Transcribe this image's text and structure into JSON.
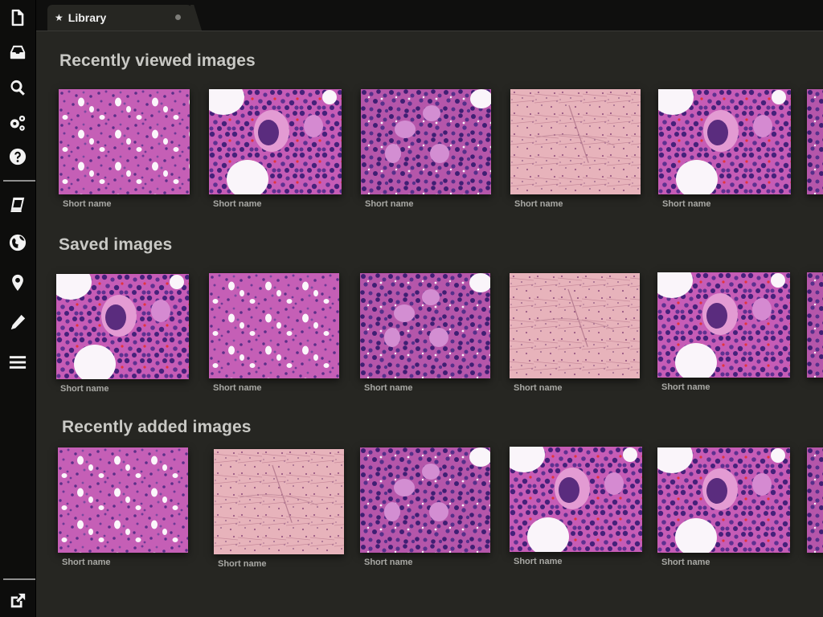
{
  "tabs": [
    {
      "icon": "star-icon",
      "label": "Library"
    }
  ],
  "sidebar": {
    "top_items": [
      {
        "icon": "file-icon"
      },
      {
        "icon": "inbox-icon"
      },
      {
        "icon": "search-icon"
      },
      {
        "icon": "gears-icon"
      },
      {
        "icon": "help-icon"
      }
    ],
    "mid_items": [
      {
        "icon": "book-icon"
      },
      {
        "icon": "globe-icon"
      },
      {
        "icon": "map-marker-icon"
      },
      {
        "icon": "pencil-icon"
      },
      {
        "icon": "menu-icon"
      }
    ],
    "bottom_items": [
      {
        "icon": "external-link-icon"
      }
    ]
  },
  "sections": [
    {
      "title": "Recently viewed images",
      "images": [
        {
          "name": "Short name",
          "tissue": "fat"
        },
        {
          "name": "Short name",
          "tissue": "mega"
        },
        {
          "name": "Short name",
          "tissue": "cluster"
        },
        {
          "name": "Short name",
          "tissue": "pale"
        },
        {
          "name": "Short name",
          "tissue": "mega"
        },
        {
          "name": "",
          "tissue": "cluster"
        }
      ]
    },
    {
      "title": "Saved images",
      "images": [
        {
          "name": "Short name",
          "tissue": "mega"
        },
        {
          "name": "Short name",
          "tissue": "fat"
        },
        {
          "name": "Short name",
          "tissue": "cluster"
        },
        {
          "name": "Short name",
          "tissue": "pale"
        },
        {
          "name": "Short name",
          "tissue": "mega"
        },
        {
          "name": "",
          "tissue": "cluster"
        }
      ]
    },
    {
      "title": "Recently added images",
      "images": [
        {
          "name": "Short name",
          "tissue": "fat"
        },
        {
          "name": "Short name",
          "tissue": "pale"
        },
        {
          "name": "Short name",
          "tissue": "cluster"
        },
        {
          "name": "Short name",
          "tissue": "mega"
        },
        {
          "name": "Short name",
          "tissue": "mega"
        },
        {
          "name": "",
          "tissue": "cluster"
        }
      ]
    }
  ],
  "colors": {
    "background": "#262622",
    "sidebar": "#0d0d0c",
    "title_text": "#c9c9c5",
    "caption_text": "#a8a8a4"
  }
}
